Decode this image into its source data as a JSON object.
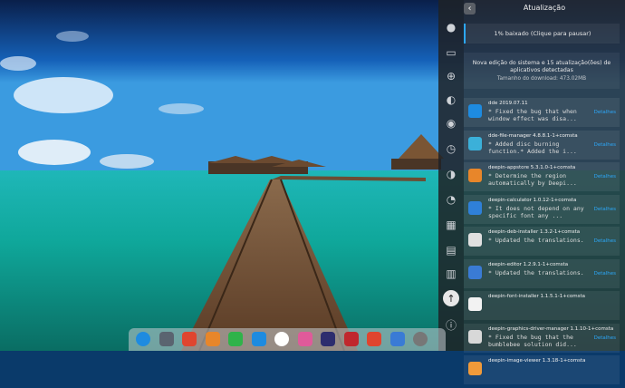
{
  "panel": {
    "title": "Atualização",
    "back_icon": "chevron-left-icon",
    "progress_text": "1% baixado (Clique para pausar)",
    "progress_percent": 1,
    "info_line": "Nova edição do sistema e 15 atualização(ões) de aplicativos detectadas",
    "download_size": "Tamanho do download: 473.02MB",
    "details_label": "Detalhes",
    "nav_icons": [
      "user-icon",
      "display-icon",
      "network-icon",
      "personalization-icon",
      "sound-icon",
      "time-icon",
      "power-icon",
      "mouse-icon",
      "keyboard-icon",
      "update-icon",
      "info-icon"
    ],
    "updates": [
      {
        "name": "dde 2019.07.11",
        "desc": "* Fixed the bug that when\nwindow effect was disa...",
        "icon": "deepin-logo-icon",
        "color": "#1e8be0"
      },
      {
        "name": "dde-file-manager 4.8.8.1-1+comsta",
        "desc": "* Added disc burning\nfunction.* Added the i...",
        "icon": "file-manager-icon",
        "color": "#3bb0d9"
      },
      {
        "name": "deepin-appstore 5.3.1.0-1+comsta",
        "desc": "* Determine the region\nautomatically by Deepi...",
        "icon": "appstore-icon",
        "color": "#e8862a"
      },
      {
        "name": "deepin-calculator 1.0.12-1+comsta",
        "desc": "* It does not depend on any\nspecific font any ...",
        "icon": "calculator-icon",
        "color": "#2f80d8"
      },
      {
        "name": "deepin-deb-installer 1.3.2-1+comsta",
        "desc": "* Updated the translations.",
        "icon": "deb-installer-icon",
        "color": "#e0e0e0"
      },
      {
        "name": "deepin-editor 1.2.9.1-1+comsta",
        "desc": "* Updated the translations.",
        "icon": "editor-icon",
        "color": "#3a7bd5"
      },
      {
        "name": "deepin-font-installer 1.1.5.1-1+comsta",
        "desc": "",
        "icon": "font-installer-icon",
        "color": "#f2f2f2"
      },
      {
        "name": "deepin-graphics-driver-manager 1.1.10-1+comsta",
        "desc": "* Fixed the bug that the\nbumblebee solution did...",
        "icon": "gpu-icon",
        "color": "#d8d8d8"
      },
      {
        "name": "deepin-image-viewer 1.3.18-1+comsta",
        "desc": "",
        "icon": "image-viewer-icon",
        "color": "#f09a3a"
      }
    ]
  },
  "dock": {
    "apps": [
      "launcher-icon",
      "multitasking-icon",
      "screen-recorder-icon",
      "appstore-icon",
      "deepin-music-icon",
      "deepin-movie-icon",
      "chrome-icon",
      "control-center-icon",
      "system-monitor-icon",
      "terminal-icon",
      "wps-presentation-icon",
      "wps-writer-icon",
      "show-desktop-icon"
    ]
  }
}
